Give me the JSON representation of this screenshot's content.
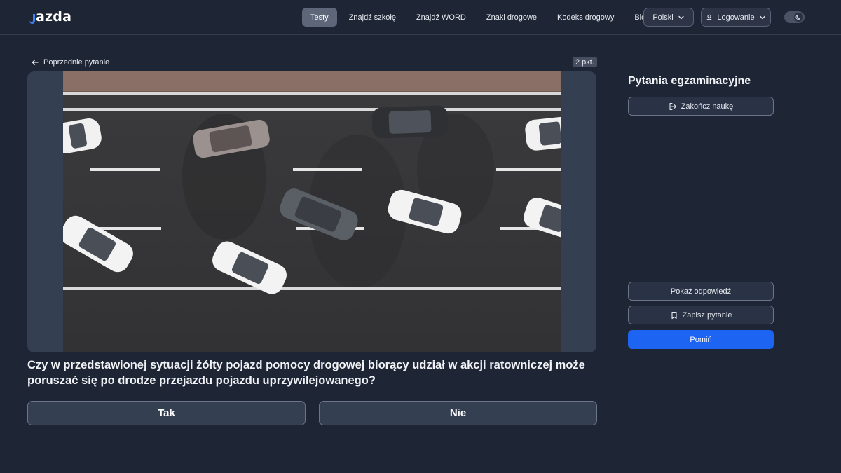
{
  "header": {
    "logo_text": "jazda",
    "nav": [
      {
        "label": "Testy",
        "active": true
      },
      {
        "label": "Znajdź szkołę",
        "active": false
      },
      {
        "label": "Znajdź WORD",
        "active": false
      },
      {
        "label": "Znaki drogowe",
        "active": false
      },
      {
        "label": "Kodeks drogowy",
        "active": false
      },
      {
        "label": "Blog",
        "active": false
      }
    ],
    "language_label": "Polski",
    "login_label": "Logowanie"
  },
  "main": {
    "back_label": "Poprzednie pytanie",
    "points_label": "2 pkt.",
    "question_text": "Czy w przedstawionej sytuacji żółty pojazd pomocy drogowej biorący udział w akcji ratowniczej może poruszać się po drodze przejazdu pojazdu uprzywilejowanego?",
    "answers": [
      {
        "label": "Tak"
      },
      {
        "label": "Nie"
      }
    ]
  },
  "sidebar": {
    "title": "Pytania egzaminacyjne",
    "end_label": "Zakończ naukę",
    "show_answer_label": "Pokaż odpowiedź",
    "save_label": "Zapisz pytanie",
    "skip_label": "Pomiń"
  },
  "colors": {
    "background": "#1e2535",
    "primary": "#1d64f2",
    "logo_accent": "#3b82f6"
  }
}
